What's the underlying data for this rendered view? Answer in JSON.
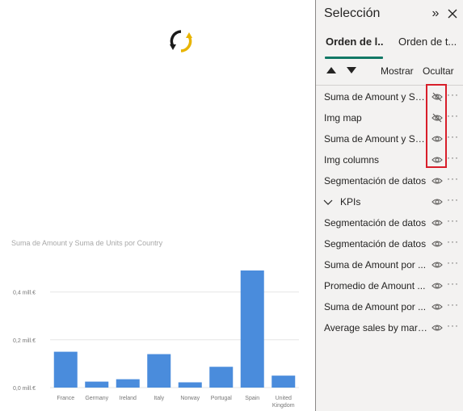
{
  "pane": {
    "title": "Selección",
    "tabs": [
      {
        "label": "Orden de l..."
      },
      {
        "label": "Orden de t..."
      }
    ],
    "show_label": "Mostrar",
    "hide_label": "Ocultar",
    "items": [
      {
        "label": "Suma de Amount y Su...",
        "visible": false
      },
      {
        "label": "Img map",
        "visible": false
      },
      {
        "label": "Suma de Amount y Su...",
        "visible": true
      },
      {
        "label": "Img columns",
        "visible": true
      },
      {
        "label": "Segmentación de datos",
        "visible": true
      },
      {
        "label": "KPIs",
        "visible": true,
        "group": true
      },
      {
        "label": "Segmentación de datos",
        "visible": true
      },
      {
        "label": "Segmentación de datos",
        "visible": true
      },
      {
        "label": "Suma de Amount por ...",
        "visible": true
      },
      {
        "label": "Promedio de Amount ...",
        "visible": true
      },
      {
        "label": "Suma de Amount por ...",
        "visible": true
      },
      {
        "label": "Average sales by mari...",
        "visible": true
      }
    ]
  },
  "chart_data": {
    "type": "bar",
    "title": "Suma de Amount y Suma de Units por Country",
    "categories": [
      "France",
      "Germany",
      "Ireland",
      "Italy",
      "Norway",
      "Portugal",
      "Spain",
      "United Kingdom"
    ],
    "values": [
      0.15,
      0.025,
      0.035,
      0.14,
      0.022,
      0.087,
      0.49,
      0.05
    ],
    "ylim": [
      0,
      0.5
    ],
    "yticks": [
      "0,0 mill.€",
      "0,2 mill.€",
      "0,4 mill.€"
    ],
    "ytick_values": [
      0,
      0.2,
      0.4
    ],
    "bar_color": "#4a8cdc",
    "grid": true
  },
  "colors": {
    "accent": "#117865",
    "highlight": "#d81e2a"
  }
}
